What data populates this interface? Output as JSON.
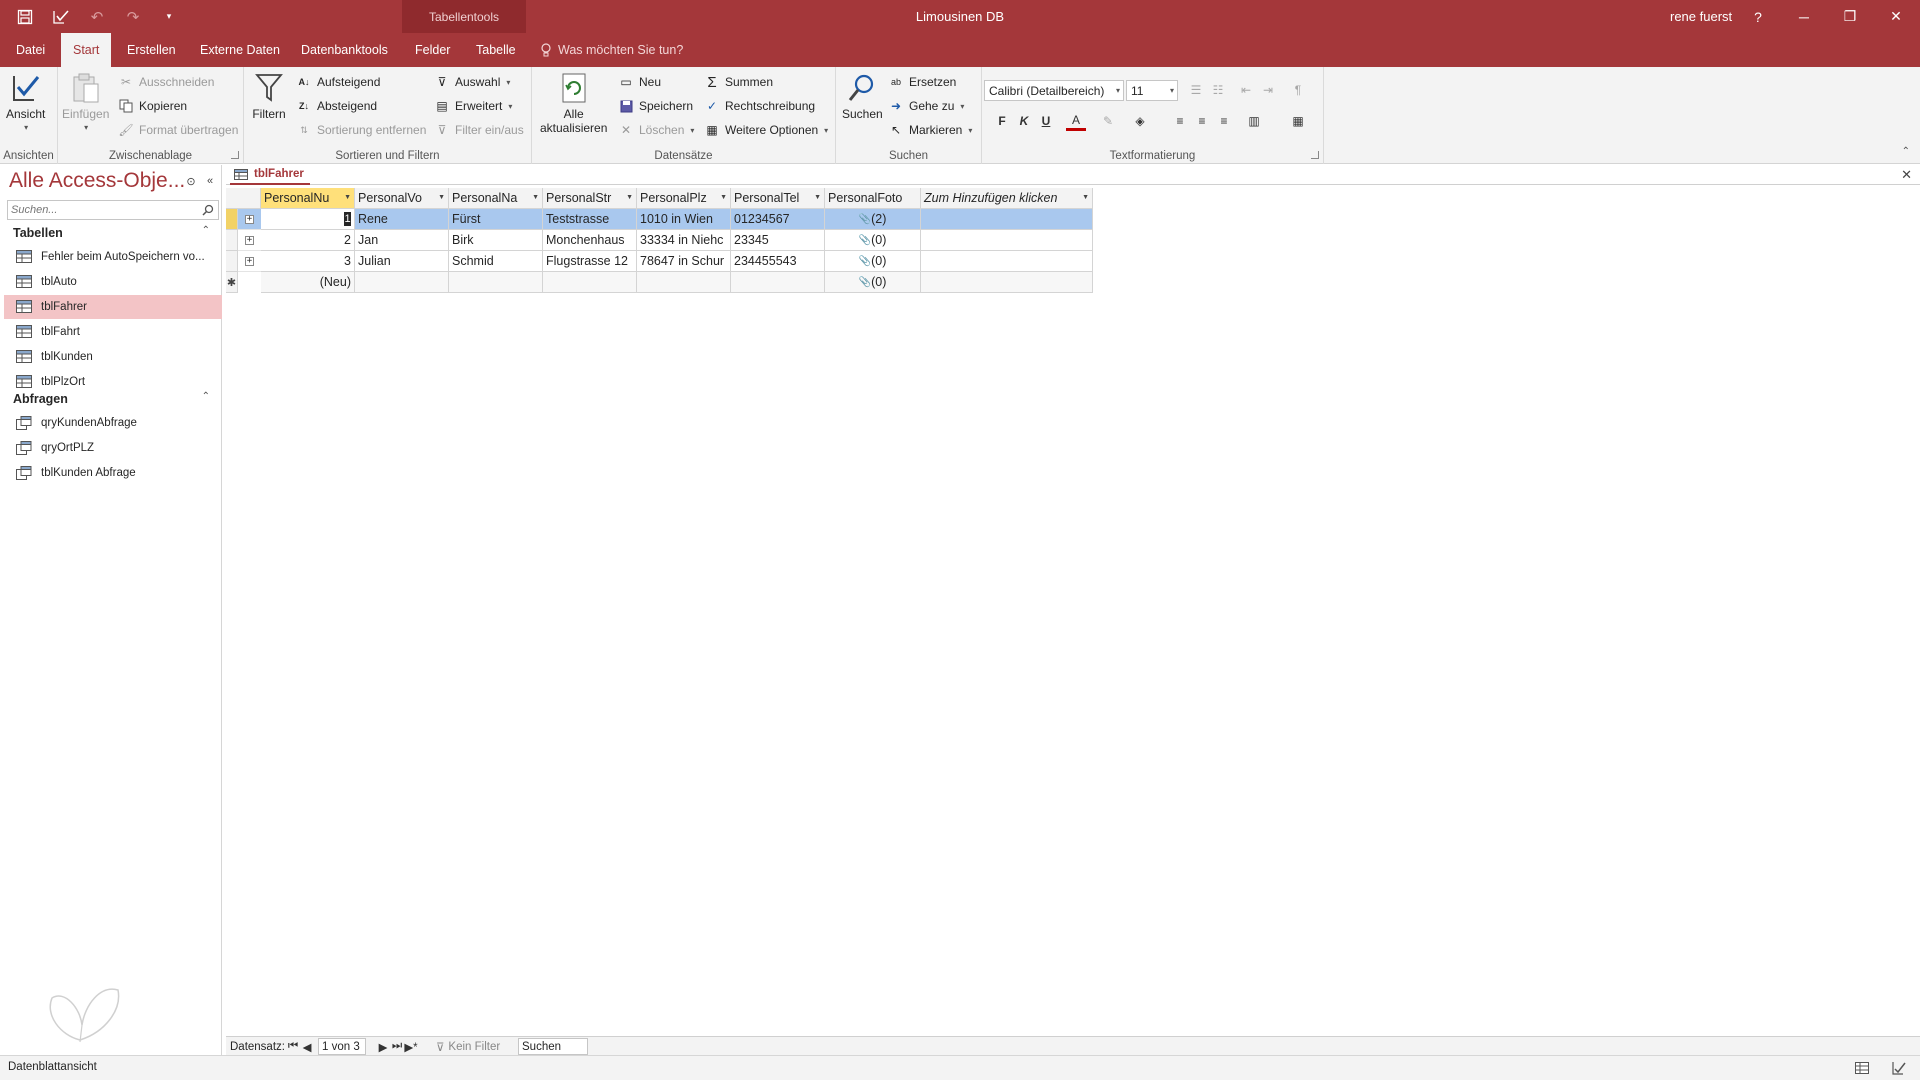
{
  "window": {
    "context_group": "Tabellentools",
    "title": "Limousinen DB",
    "user": "rene fuerst",
    "help": "?",
    "minimize": "─",
    "restore": "❐",
    "close": "✕"
  },
  "tabs": [
    "Datei",
    "Start",
    "Erstellen",
    "Externe Daten",
    "Datenbanktools",
    "Felder",
    "Tabelle"
  ],
  "active_tab": "Start",
  "tell_me": "Was möchten Sie tun?",
  "ribbon": {
    "ansichten": {
      "label": "Ansichten",
      "ansicht": "Ansicht"
    },
    "zwischenablage": {
      "label": "Zwischenablage",
      "einfuegen": "Einfügen",
      "ausschneiden": "Ausschneiden",
      "kopieren": "Kopieren",
      "format_uebertragen": "Format übertragen"
    },
    "sortieren": {
      "label": "Sortieren und Filtern",
      "filtern": "Filtern",
      "aufsteigend": "Aufsteigend",
      "absteigend": "Absteigend",
      "sortierung_entfernen": "Sortierung entfernen",
      "auswahl": "Auswahl",
      "erweitert": "Erweitert",
      "filter_ein_aus": "Filter ein/aus"
    },
    "datensaetze": {
      "label": "Datensätze",
      "alle": "Alle",
      "aktualisieren": "aktualisieren",
      "neu": "Neu",
      "speichern": "Speichern",
      "loeschen": "Löschen",
      "summen": "Summen",
      "rechtschreibung": "Rechtschreibung",
      "weitere_optionen": "Weitere Optionen"
    },
    "suchen": {
      "label": "Suchen",
      "suchen": "Suchen",
      "ersetzen": "Ersetzen",
      "gehe_zu": "Gehe zu",
      "markieren": "Markieren"
    },
    "textformatierung": {
      "label": "Textformatierung",
      "font": "Calibri (Detailbereich)",
      "size": "11",
      "bold": "F",
      "italic": "K",
      "underline": "U"
    }
  },
  "nav": {
    "title": "Alle Access-Obje...",
    "search_placeholder": "Suchen...",
    "sections": [
      {
        "label": "Tabellen",
        "items": [
          "Fehler beim AutoSpeichern vo...",
          "tblAuto",
          "tblFahrer",
          "tblFahrt",
          "tblKunden",
          "tblPlzOrt"
        ]
      },
      {
        "label": "Abfragen",
        "items": [
          "qryKundenAbfrage",
          "qryOrtPLZ",
          "tblKunden Abfrage"
        ]
      }
    ],
    "selected": "tblFahrer"
  },
  "document": {
    "tab": "tblFahrer",
    "columns": [
      "PersonalNu",
      "PersonalVo",
      "PersonalNa",
      "PersonalStr",
      "PersonalPlz",
      "PersonalTel",
      "PersonalFoto",
      "Zum Hinzufügen klicken"
    ],
    "rows": [
      {
        "nr": "1",
        "vorname": "Rene",
        "nachname": "Fürst",
        "strasse": "Teststrasse",
        "plz": "1010 in Wien",
        "tel": "01234567",
        "foto": "(2)"
      },
      {
        "nr": "2",
        "vorname": "Jan",
        "nachname": "Birk",
        "strasse": "Monchenhaus",
        "plz": "33334 in Niehc",
        "tel": "23345",
        "foto": "(0)"
      },
      {
        "nr": "3",
        "vorname": "Julian",
        "nachname": "Schmid",
        "strasse": "Flugstrasse 12",
        "plz": "78647 in Schur",
        "tel": "234455543",
        "foto": "(0)"
      }
    ],
    "new_row": {
      "label": "(Neu)",
      "foto": "(0)"
    }
  },
  "recnav": {
    "label": "Datensatz:",
    "position": "1 von 3",
    "filter": "Kein Filter",
    "search": "Suchen"
  },
  "status": {
    "text": "Datenblattansicht"
  },
  "colors": {
    "accent": "#a4373a",
    "selection": "#a9c8ee",
    "nav_selected": "#f3c4c6",
    "active_header": "#ffe07a"
  }
}
